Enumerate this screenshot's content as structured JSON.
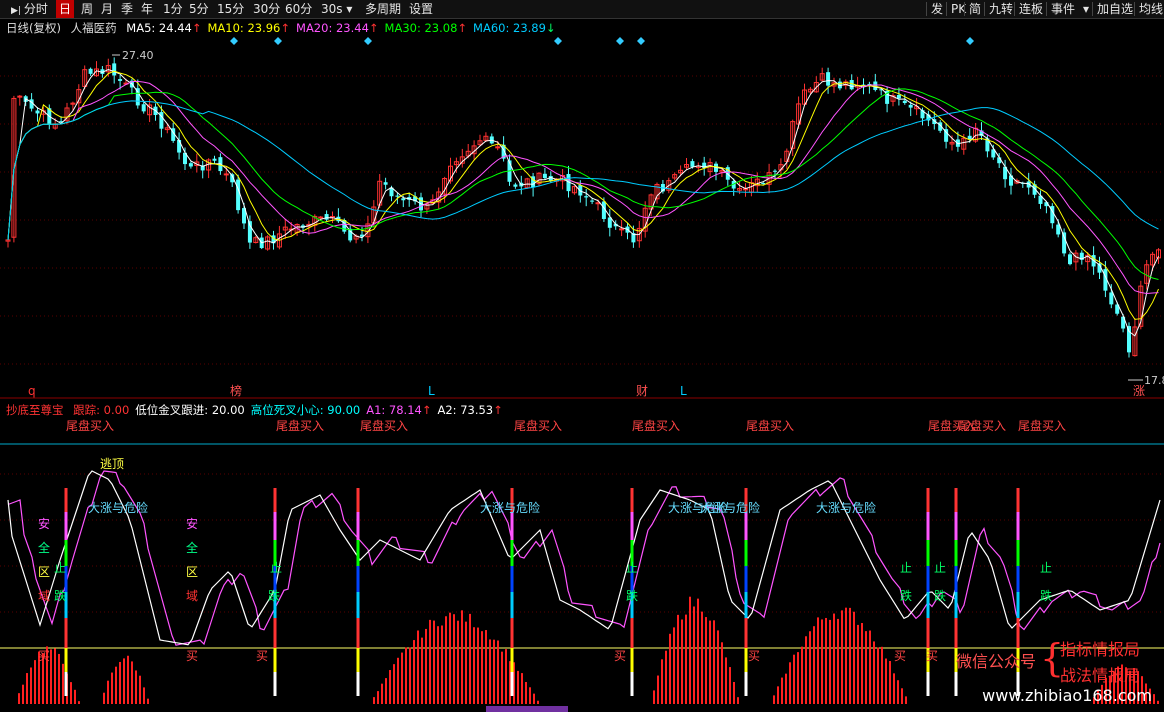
{
  "toolbar": {
    "left_items": [
      {
        "label": "分时",
        "icon": "play-bar-icon",
        "active": false
      },
      {
        "label": "日",
        "active": true
      },
      {
        "label": "周",
        "active": false
      },
      {
        "label": "月",
        "active": false
      },
      {
        "label": "季",
        "active": false
      },
      {
        "label": "年",
        "active": false
      },
      {
        "label": "1分",
        "active": false
      },
      {
        "label": "5分",
        "active": false
      },
      {
        "label": "15分",
        "active": false
      },
      {
        "label": "30分",
        "active": false
      },
      {
        "label": "60分",
        "active": false
      }
    ],
    "period_select": "30s",
    "multi_period": "多周期",
    "settings": "设置",
    "right_items": [
      "发",
      "PK",
      "简",
      "九转",
      "连板",
      "事件",
      "加自选",
      "均线"
    ]
  },
  "main_info": {
    "chart_mode": "日线(复权)",
    "stock_name": "人福医药",
    "ma": [
      {
        "label": "MA5: 24.44",
        "arrow": "↑",
        "color": "#ffffff"
      },
      {
        "label": "MA10: 23.96",
        "arrow": "↑",
        "color": "#ffff00"
      },
      {
        "label": "MA20: 23.44",
        "arrow": "↑",
        "color": "#ff55ff"
      },
      {
        "label": "MA30: 23.08",
        "arrow": "↑",
        "color": "#00ff00"
      },
      {
        "label": "MA60: 23.89",
        "arrow": "↓",
        "color": "#00ccff"
      }
    ]
  },
  "sub_info": {
    "indicator_name": "抄底至尊宝",
    "items": [
      {
        "label": "跟踪: 0.00",
        "color": "#ff3333",
        "arrow": ""
      },
      {
        "label": "低位金叉跟进: 20.00",
        "color": "#ffffff",
        "arrow": ""
      },
      {
        "label": "高位死叉小心: 90.00",
        "color": "#00ffff",
        "arrow": ""
      },
      {
        "label": "A1: 78.14",
        "color": "#ff55ff",
        "arrow": "↑"
      },
      {
        "label": "A2: 73.53",
        "color": "#ffffff",
        "arrow": "↑"
      }
    ]
  },
  "price_labels": {
    "high": "27.40",
    "low": "17.8"
  },
  "event_markers": [
    {
      "text": "q",
      "color": "#ff3333"
    },
    {
      "text": "榜",
      "color": "#ff5050"
    },
    {
      "text": "L",
      "color": "#00ccff"
    },
    {
      "text": "财",
      "color": "#ff5050"
    },
    {
      "text": "L",
      "color": "#00ccff"
    },
    {
      "text": "涨",
      "color": "#ff5050"
    }
  ],
  "sub_labels": {
    "tail_buy": "尾盘买入",
    "escape_top": "逃顶",
    "big_rise_danger": "大涨与危险",
    "safe_zone": [
      "安",
      "全",
      "区",
      "域"
    ],
    "stop": "止",
    "fall": "跌",
    "buy": "买"
  },
  "watermark": {
    "wechat": "微信公众号",
    "line1": "指标情报局",
    "line2": "战法情报局",
    "site": "www.zhibiao168.com"
  },
  "colors": {
    "up": "#ff3232",
    "down": "#54ffff",
    "background": "#000000",
    "accent": "#c00000"
  }
}
